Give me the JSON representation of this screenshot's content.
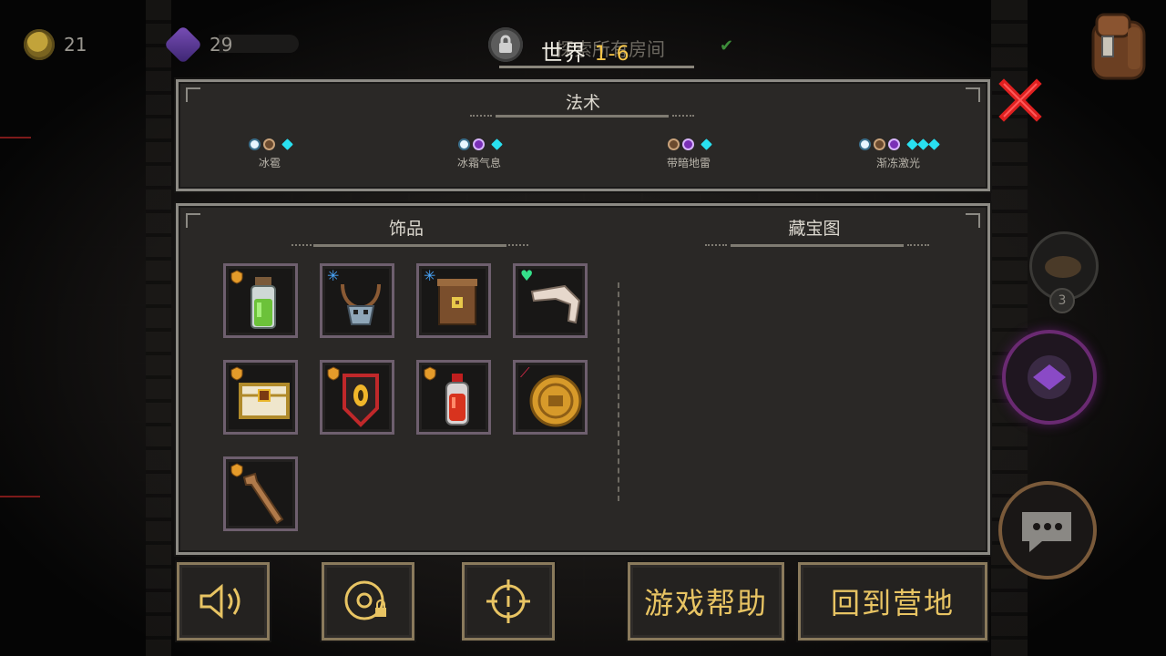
{
  "hud": {
    "coins": "21",
    "gems": "29",
    "world_label": "世界",
    "world_number": "1-6",
    "objective_text": "探索所有房间",
    "map_count": "3"
  },
  "spells_panel": {
    "title": "法术",
    "spells": [
      {
        "name": "冰雹",
        "elements": [
          "ice-icon",
          "earth-icon"
        ],
        "mana_cost": 1
      },
      {
        "name": "冰霜气息",
        "elements": [
          "ice-icon",
          "shadow-icon"
        ],
        "mana_cost": 1
      },
      {
        "name": "带暗地雷",
        "elements": [
          "earth-icon",
          "shadow-icon"
        ],
        "mana_cost": 1
      },
      {
        "name": "渐冻激光",
        "elements": [
          "ice-icon",
          "earth-icon",
          "shadow-icon"
        ],
        "mana_cost": 3
      }
    ]
  },
  "items_panel": {
    "relics_title": "饰品",
    "treasure_title": "藏宝图",
    "relics": [
      {
        "icon": "green-potion-icon",
        "rarity": "shield-badge"
      },
      {
        "icon": "skull-necklace-icon",
        "rarity": "frost-badge"
      },
      {
        "icon": "scroll-icon",
        "rarity": "frost-badge"
      },
      {
        "icon": "bone-icon",
        "rarity": "heart-badge"
      },
      {
        "icon": "treasure-chest-icon",
        "rarity": "shield-badge"
      },
      {
        "icon": "shield-emblem-icon",
        "rarity": "shield-badge"
      },
      {
        "icon": "red-potion-icon",
        "rarity": "shield-badge"
      },
      {
        "icon": "gold-coin-relic-icon",
        "rarity": "sword-badge"
      },
      {
        "icon": "wooden-cane-icon",
        "rarity": "shield-badge"
      }
    ]
  },
  "buttons": {
    "sound": "speaker-icon",
    "lock_target": "locked-target-icon",
    "crosshair": "crosshair-icon",
    "help": "游戏帮助",
    "return_camp": "回到营地"
  },
  "colors": {
    "accent_gold": "#e8c463",
    "panel_bg": "#2a2826",
    "close_red": "#e02020",
    "mana_cyan": "#29e0f0"
  }
}
